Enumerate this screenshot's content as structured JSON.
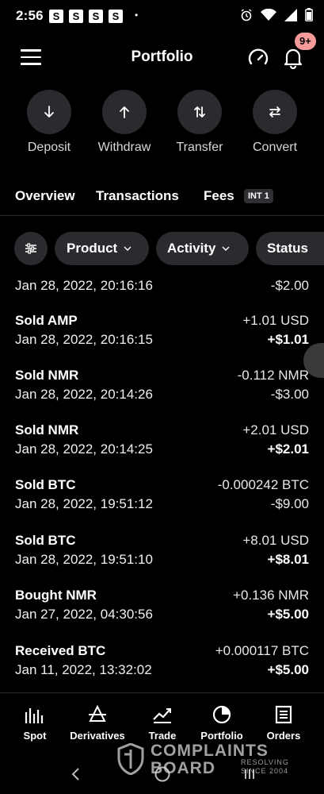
{
  "status_bar": {
    "time": "2:56",
    "notification_letters": [
      "S",
      "S",
      "S",
      "S"
    ],
    "dot": "•"
  },
  "header": {
    "title": "Portfolio",
    "notification_badge": "9+"
  },
  "actions": [
    {
      "label": "Deposit",
      "icon": "arrow-down-icon"
    },
    {
      "label": "Withdraw",
      "icon": "arrow-up-icon"
    },
    {
      "label": "Transfer",
      "icon": "transfer-icon"
    },
    {
      "label": "Convert",
      "icon": "convert-icon"
    }
  ],
  "tabs": {
    "overview": "Overview",
    "transactions": "Transactions",
    "fees": "Fees",
    "fees_badge": "INT 1"
  },
  "filters": {
    "product": "Product",
    "activity": "Activity",
    "status": "Status"
  },
  "transactions": [
    {
      "title": "",
      "date": "Jan 28, 2022, 20:16:16",
      "amount_crypto": "",
      "amount_usd": "-$2.00",
      "usd_bold": false
    },
    {
      "title": "Sold AMP",
      "date": "Jan 28, 2022, 20:16:15",
      "amount_crypto": "+1.01 USD",
      "amount_usd": "+$1.01",
      "usd_bold": true
    },
    {
      "title": "Sold NMR",
      "date": "Jan 28, 2022, 20:14:26",
      "amount_crypto": "-0.112 NMR",
      "amount_usd": "-$3.00",
      "usd_bold": false
    },
    {
      "title": "Sold NMR",
      "date": "Jan 28, 2022, 20:14:25",
      "amount_crypto": "+2.01 USD",
      "amount_usd": "+$2.01",
      "usd_bold": true
    },
    {
      "title": "Sold BTC",
      "date": "Jan 28, 2022, 19:51:12",
      "amount_crypto": "-0.000242 BTC",
      "amount_usd": "-$9.00",
      "usd_bold": false
    },
    {
      "title": "Sold BTC",
      "date": "Jan 28, 2022, 19:51:10",
      "amount_crypto": "+8.01 USD",
      "amount_usd": "+$8.01",
      "usd_bold": true
    },
    {
      "title": "Bought NMR",
      "date": "Jan 27, 2022, 04:30:56",
      "amount_crypto": "+0.136 NMR",
      "amount_usd": "+$5.00",
      "usd_bold": true
    },
    {
      "title": "Received BTC",
      "date": "Jan 11, 2022, 13:32:02",
      "amount_crypto": "+0.000117 BTC",
      "amount_usd": "+$5.00",
      "usd_bold": true
    }
  ],
  "bottom_nav": [
    {
      "label": "Spot",
      "icon": "bar-chart-icon"
    },
    {
      "label": "Derivatives",
      "icon": "derivatives-icon"
    },
    {
      "label": "Trade",
      "icon": "trade-chart-icon"
    },
    {
      "label": "Portfolio",
      "icon": "pie-chart-icon"
    },
    {
      "label": "Orders",
      "icon": "orders-list-icon"
    }
  ],
  "watermark": {
    "line1": "COMPLAINTS",
    "line2": "BOARD",
    "sub1": "RESOLVING",
    "sub2": "SINCE 2004"
  }
}
